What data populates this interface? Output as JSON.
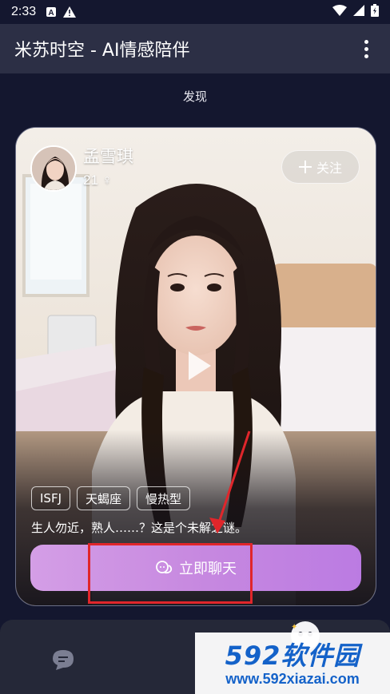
{
  "status_bar": {
    "time": "2:33"
  },
  "app_bar": {
    "title": "米苏时空 - AI情感陪伴"
  },
  "section": {
    "title": "发现"
  },
  "profile": {
    "name": "孟雪琪",
    "age": "21 ♀",
    "follow_label": "关注",
    "tags": [
      "ISFJ",
      "天蝎座",
      "慢热型"
    ],
    "bio": "生人勿近，熟人……？这是个未解之谜。",
    "chat_label": "立即聊天"
  },
  "watermark": {
    "main": "592软件园",
    "url": "www.592xiazai.com"
  },
  "colors": {
    "chat_button": "#c789e0",
    "background": "#14172f",
    "highlight": "#e0262b",
    "watermark": "#1462c9"
  }
}
